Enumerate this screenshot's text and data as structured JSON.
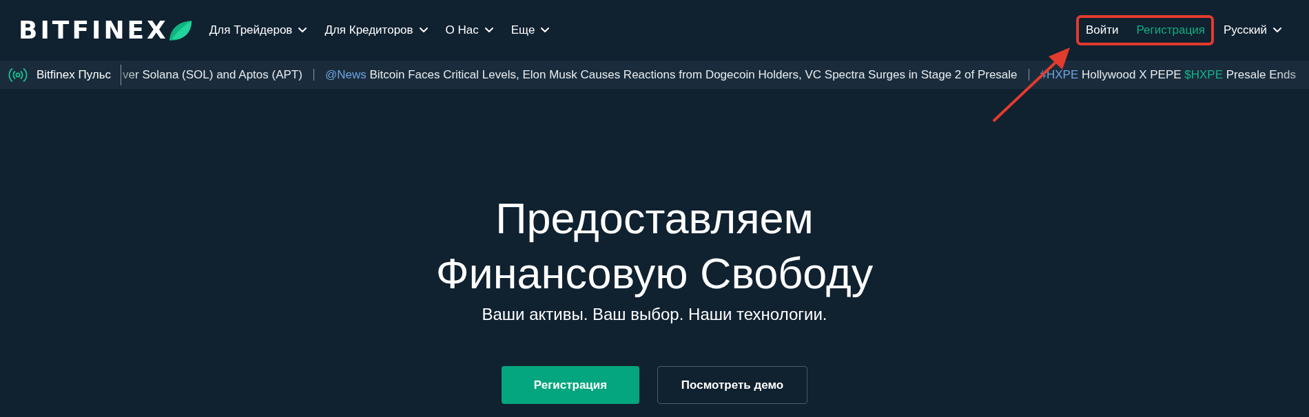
{
  "header": {
    "logo": {
      "wordmark": "BITFINEX"
    },
    "nav": [
      {
        "label": "Для Трейдеров",
        "has_menu": true
      },
      {
        "label": "Для Кредиторов",
        "has_menu": true
      },
      {
        "label": "О Нас",
        "has_menu": true
      },
      {
        "label": "Еще",
        "has_menu": true
      }
    ],
    "auth": {
      "highlighted": true,
      "login": "Войти",
      "register": "Регистрация"
    },
    "language": {
      "label": "Русский",
      "has_menu": true
    }
  },
  "ticker": {
    "title": "Bitfinex Пульс",
    "items": [
      {
        "segments": [
          {
            "kind": "text",
            "text": "ver Solana (SOL) and Aptos (APT)"
          }
        ]
      },
      {
        "segments": [
          {
            "kind": "tag",
            "text": "@News"
          },
          {
            "kind": "text",
            "text": "Bitcoin Faces Critical Levels, Elon Musk Causes Reactions from Dogecoin Holders, VC Spectra Surges in Stage 2 of Presale"
          }
        ]
      },
      {
        "segments": [
          {
            "kind": "tag",
            "text": "#HXPE"
          },
          {
            "kind": "text",
            "text": "Hollywood X PEPE"
          },
          {
            "kind": "symbol",
            "text": "$HXPE"
          },
          {
            "kind": "text",
            "text": "Presale Ends"
          }
        ]
      }
    ]
  },
  "hero": {
    "title": "Предоставляем Финансовую Свободу",
    "subtitle": "Ваши активы. Ваш выбор. Наши технологии.",
    "buttons": [
      {
        "label": "Регистрация",
        "kind": "primary"
      },
      {
        "label": "Посмотреть демо",
        "kind": "outline"
      }
    ]
  }
}
